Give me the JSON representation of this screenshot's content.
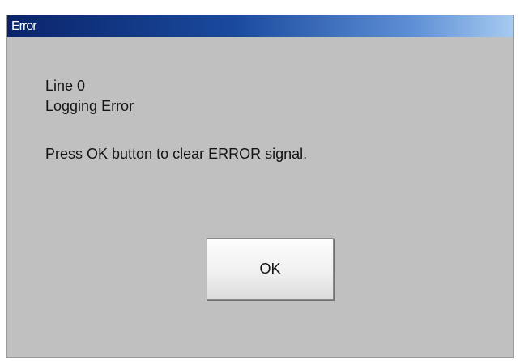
{
  "window": {
    "title": "Error"
  },
  "message": {
    "line1": "Line 0",
    "line2": "Logging Error",
    "line3": "Press OK button to clear ERROR signal."
  },
  "buttons": {
    "ok_label": "OK"
  },
  "colors": {
    "titlebar_start": "#0a246a",
    "titlebar_end": "#a6caf0",
    "dialog_background": "#c0c0c0"
  }
}
